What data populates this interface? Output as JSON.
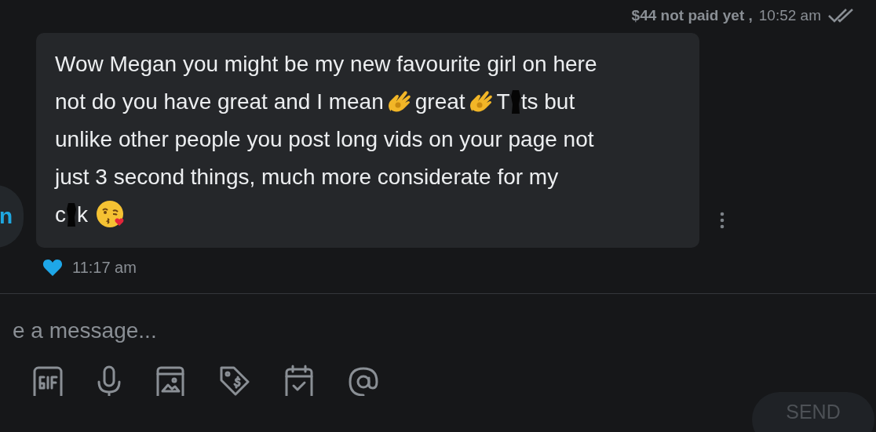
{
  "header": {
    "payment_status": "$44 not paid yet ,",
    "time": "10:52 am",
    "read": true
  },
  "avatar": {
    "letter": "n"
  },
  "message": {
    "lines": [
      [
        {
          "kind": "text",
          "text": "Wow Megan you might be my new favourite girl on here"
        }
      ],
      [
        {
          "kind": "text",
          "text": "not do you have great and I mean"
        },
        {
          "kind": "ok_hand"
        },
        {
          "kind": "text",
          "text": "great"
        },
        {
          "kind": "ok_hand"
        },
        {
          "kind": "text",
          "text": "T"
        },
        {
          "kind": "redaction"
        },
        {
          "kind": "text",
          "text": "ts but"
        }
      ],
      [
        {
          "kind": "text",
          "text": "unlike other people you post long vids on your page not"
        }
      ],
      [
        {
          "kind": "text",
          "text": "just 3 second things, much more considerate for my"
        }
      ],
      [
        {
          "kind": "text",
          "text": "c"
        },
        {
          "kind": "redaction"
        },
        {
          "kind": "text",
          "text": "k"
        },
        {
          "kind": "kissing_face"
        }
      ]
    ],
    "liked": true,
    "time": "11:17 am"
  },
  "composer": {
    "placeholder": "e a message...",
    "tools": [
      {
        "kind": "gif"
      },
      {
        "kind": "mic"
      },
      {
        "kind": "image"
      },
      {
        "kind": "price_tag"
      },
      {
        "kind": "calendar"
      },
      {
        "kind": "mention"
      }
    ],
    "send": "SEND"
  }
}
